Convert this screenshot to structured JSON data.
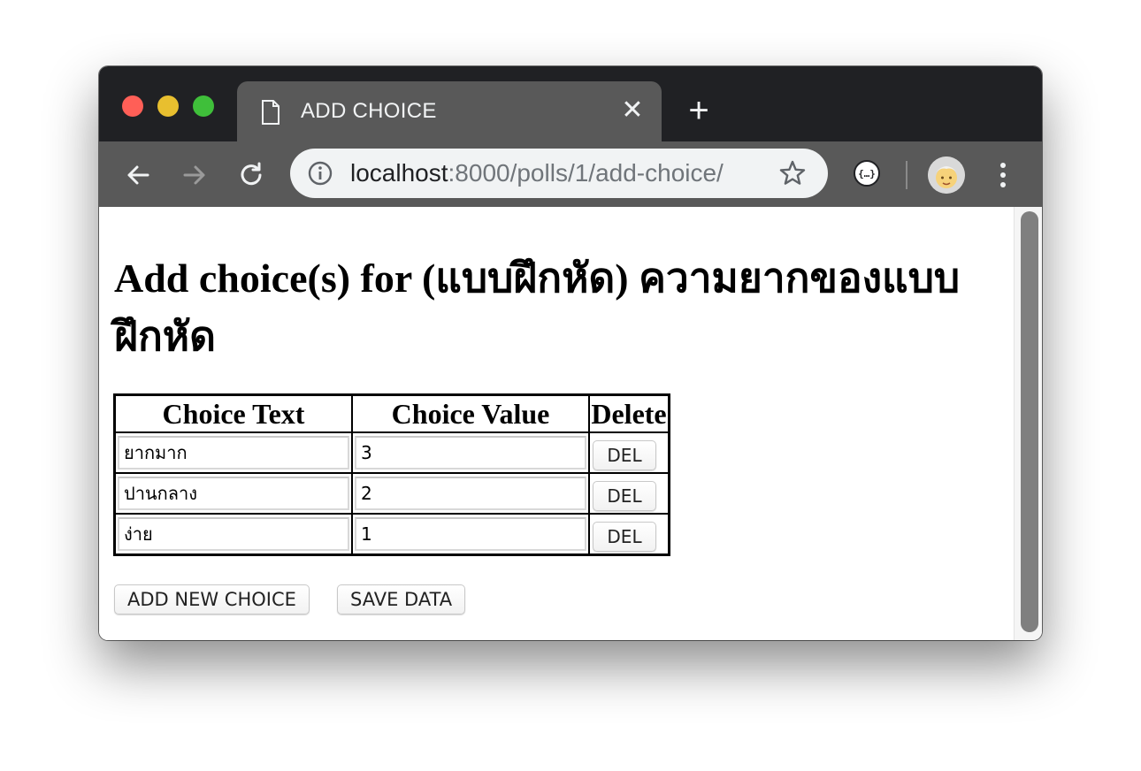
{
  "browser": {
    "tab_title": "ADD CHOICE",
    "tab_close": "✕",
    "new_tab": "+",
    "url_host": "localhost",
    "url_rest": ":8000/polls/1/add-choice/",
    "icons": {
      "page": "page-icon",
      "back": "back-arrow-icon",
      "forward": "forward-arrow-icon",
      "reload": "reload-icon",
      "info": "info-icon",
      "star": "star-icon",
      "extension": "json-extension-icon",
      "avatar": "profile-avatar",
      "menu": "kebab-menu-icon"
    },
    "colors": {
      "titlebar": "#202124",
      "toolbar": "#595959",
      "omnibox": "#f1f3f4",
      "close": "#ff5f57",
      "minimize": "#e8bf2f",
      "zoom": "#3fbf3a"
    }
  },
  "page": {
    "heading": "Add choice(s) for (แบบฝึกหัด) ความยากของแบบฝึกหัด",
    "table": {
      "headers": [
        "Choice Text",
        "Choice Value",
        "Delete"
      ],
      "rows": [
        {
          "text": "ยากมาก",
          "value": "3",
          "action": "DEL"
        },
        {
          "text": "ปานกลาง",
          "value": "2",
          "action": "DEL"
        },
        {
          "text": "ง่าย",
          "value": "1",
          "action": "DEL"
        }
      ]
    },
    "buttons": {
      "add_new": "ADD NEW CHOICE",
      "save": "SAVE DATA"
    }
  }
}
